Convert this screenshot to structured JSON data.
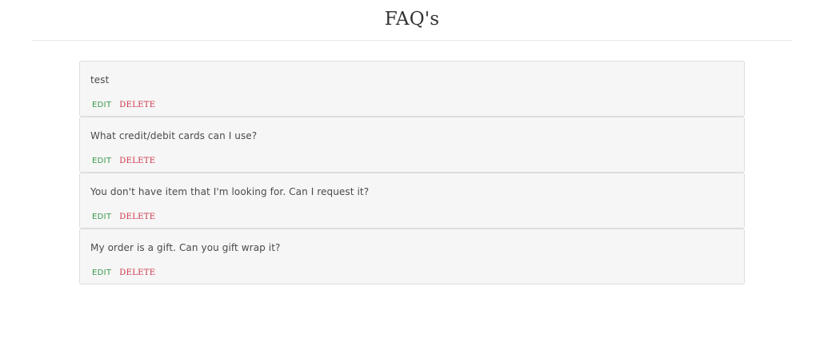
{
  "page": {
    "title": "FAQ's"
  },
  "actions": {
    "edit_label": "EDIT",
    "delete_label": "DELETE"
  },
  "faqs": [
    {
      "question": "test"
    },
    {
      "question": "What credit/debit cards can I use?"
    },
    {
      "question": "You don't have item that I'm looking for. Can I request it?"
    },
    {
      "question": "My order is a gift. Can you gift wrap it?"
    }
  ],
  "colors": {
    "edit": "#3c9a4b",
    "delete": "#cc3344",
    "card_background": "#f6f6f6",
    "card_border": "#dddddd"
  }
}
